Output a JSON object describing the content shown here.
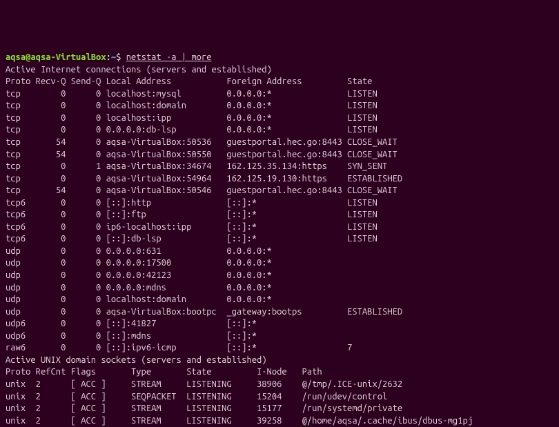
{
  "prompt": {
    "user": "aqsa",
    "at": "@",
    "host": "aqsa-VirtualBox",
    "colon": ":",
    "path": "~",
    "dollar": "$ "
  },
  "command": "netstat -a | more",
  "header_internet": "Active Internet connections (servers and established)",
  "internet_header_cols": "Proto Recv-Q Send-Q Local Address           Foreign Address         State",
  "internet_rows": [
    "tcp        0      0 localhost:mysql         0.0.0.0:*               LISTEN",
    "tcp        0      0 localhost:domain        0.0.0.0:*               LISTEN",
    "tcp        0      0 localhost:ipp           0.0.0.0:*               LISTEN",
    "tcp        0      0 0.0.0.0:db-lsp          0.0.0.0:*               LISTEN",
    "tcp       54      0 aqsa-VirtualBox:50536   guestportal.hec.go:8443 CLOSE_WAIT",
    "tcp       54      0 aqsa-VirtualBox:50550   guestportal.hec.go:8443 CLOSE_WAIT",
    "tcp        0      1 aqsa-VirtualBox:34674   162.125.35.134:https    SYN_SENT",
    "tcp        0      0 aqsa-VirtualBox:54964   162.125.19.130:https    ESTABLISHED",
    "tcp       54      0 aqsa-VirtualBox:50546   guestportal.hec.go:8443 CLOSE_WAIT",
    "tcp6       0      0 [::]:http               [::]:*                  LISTEN",
    "tcp6       0      0 [::]:ftp                [::]:*                  LISTEN",
    "tcp6       0      0 ip6-localhost:ipp       [::]:*                  LISTEN",
    "tcp6       0      0 [::]:db-lsp             [::]:*                  LISTEN",
    "udp        0      0 0.0.0.0:631             0.0.0.0:*",
    "udp        0      0 0.0.0.0:17500           0.0.0.0:*",
    "udp        0      0 0.0.0.0:42123           0.0.0.0:*",
    "udp        0      0 0.0.0.0:mdns            0.0.0.0:*",
    "udp        0      0 localhost:domain        0.0.0.0:*",
    "udp        0      0 aqsa-VirtualBox:bootpc  _gateway:bootps         ESTABLISHED",
    "udp6       0      0 [::]:41827              [::]:*",
    "udp6       0      0 [::]:mdns               [::]:*",
    "raw6       0      0 [::]:ipv6-icmp          [::]:*                  7"
  ],
  "header_unix": "Active UNIX domain sockets (servers and established)",
  "unix_header_cols": "Proto RefCnt Flags       Type       State         I-Node   Path",
  "unix_rows": [
    "unix  2      [ ACC ]     STREAM     LISTENING     38906    @/tmp/.ICE-unix/2632",
    "unix  2      [ ACC ]     SEQPACKET  LISTENING     15204    /run/udev/control",
    "unix  2      [ ACC ]     STREAM     LISTENING     15177    /run/systemd/private",
    "unix  2      [ ACC ]     STREAM     LISTENING     39258    @/home/aqsa/.cache/ibus/dbus-mg1pj"
  ]
}
